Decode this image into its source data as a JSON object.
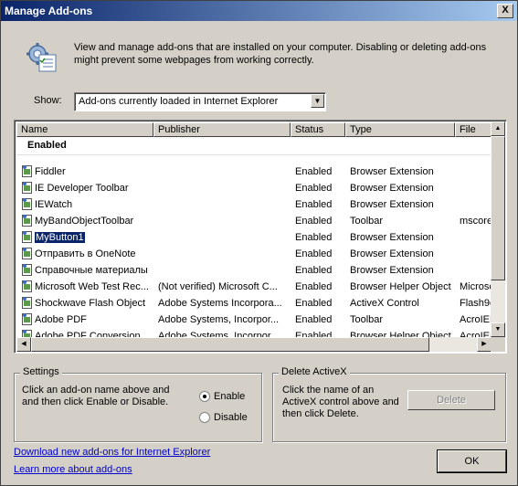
{
  "window": {
    "title": "Manage Add-ons",
    "close_label": "X"
  },
  "intro": {
    "text": "View and manage add-ons that are installed on your computer. Disabling or deleting add-ons might prevent some webpages from working correctly."
  },
  "filter": {
    "label": "Show:",
    "value": "Add-ons currently loaded in Internet Explorer"
  },
  "list": {
    "columns": [
      "Name",
      "Publisher",
      "Status",
      "Type",
      "File"
    ],
    "group": "Enabled",
    "rows": [
      {
        "name": "Fiddler",
        "publisher": "",
        "status": "Enabled",
        "type": "Browser Extension",
        "file": ""
      },
      {
        "name": "IE Developer Toolbar",
        "publisher": "",
        "status": "Enabled",
        "type": "Browser Extension",
        "file": ""
      },
      {
        "name": "IEWatch",
        "publisher": "",
        "status": "Enabled",
        "type": "Browser Extension",
        "file": ""
      },
      {
        "name": "MyBandObjectToolbar",
        "publisher": "",
        "status": "Enabled",
        "type": "Toolbar",
        "file": "mscore"
      },
      {
        "name": "MyButton1",
        "publisher": "",
        "status": "Enabled",
        "type": "Browser Extension",
        "file": ""
      },
      {
        "name": "Отправить в OneNote",
        "publisher": "",
        "status": "Enabled",
        "type": "Browser Extension",
        "file": ""
      },
      {
        "name": "Справочные материалы",
        "publisher": "",
        "status": "Enabled",
        "type": "Browser Extension",
        "file": ""
      },
      {
        "name": "Microsoft Web Test Rec...",
        "publisher": "(Not verified) Microsoft C...",
        "status": "Enabled",
        "type": "Browser Helper Object",
        "file": "Microsc"
      },
      {
        "name": "Shockwave Flash Object",
        "publisher": "Adobe Systems Incorpora...",
        "status": "Enabled",
        "type": "ActiveX Control",
        "file": "Flash9c"
      },
      {
        "name": "Adobe PDF",
        "publisher": "Adobe Systems, Incorpor...",
        "status": "Enabled",
        "type": "Toolbar",
        "file": "AcroIEF"
      },
      {
        "name": "Adobe PDF Conversion",
        "publisher": "Adobe Systems, Incorpor...",
        "status": "Enabled",
        "type": "Browser Helper Object",
        "file": "AcroIEF"
      }
    ],
    "selected_index": 4
  },
  "settings": {
    "title": "Settings",
    "text": "Click an add-on name above and and then click Enable or Disable.",
    "enable_label": "Enable",
    "disable_label": "Disable",
    "selected": "enable"
  },
  "delete_activex": {
    "title": "Delete ActiveX",
    "text": "Click the name of an ActiveX control above and then click Delete.",
    "button_label": "Delete"
  },
  "links": {
    "download": "Download new add-ons for Internet Explorer",
    "learn": "Learn more about add-ons"
  },
  "ok_label": "OK"
}
